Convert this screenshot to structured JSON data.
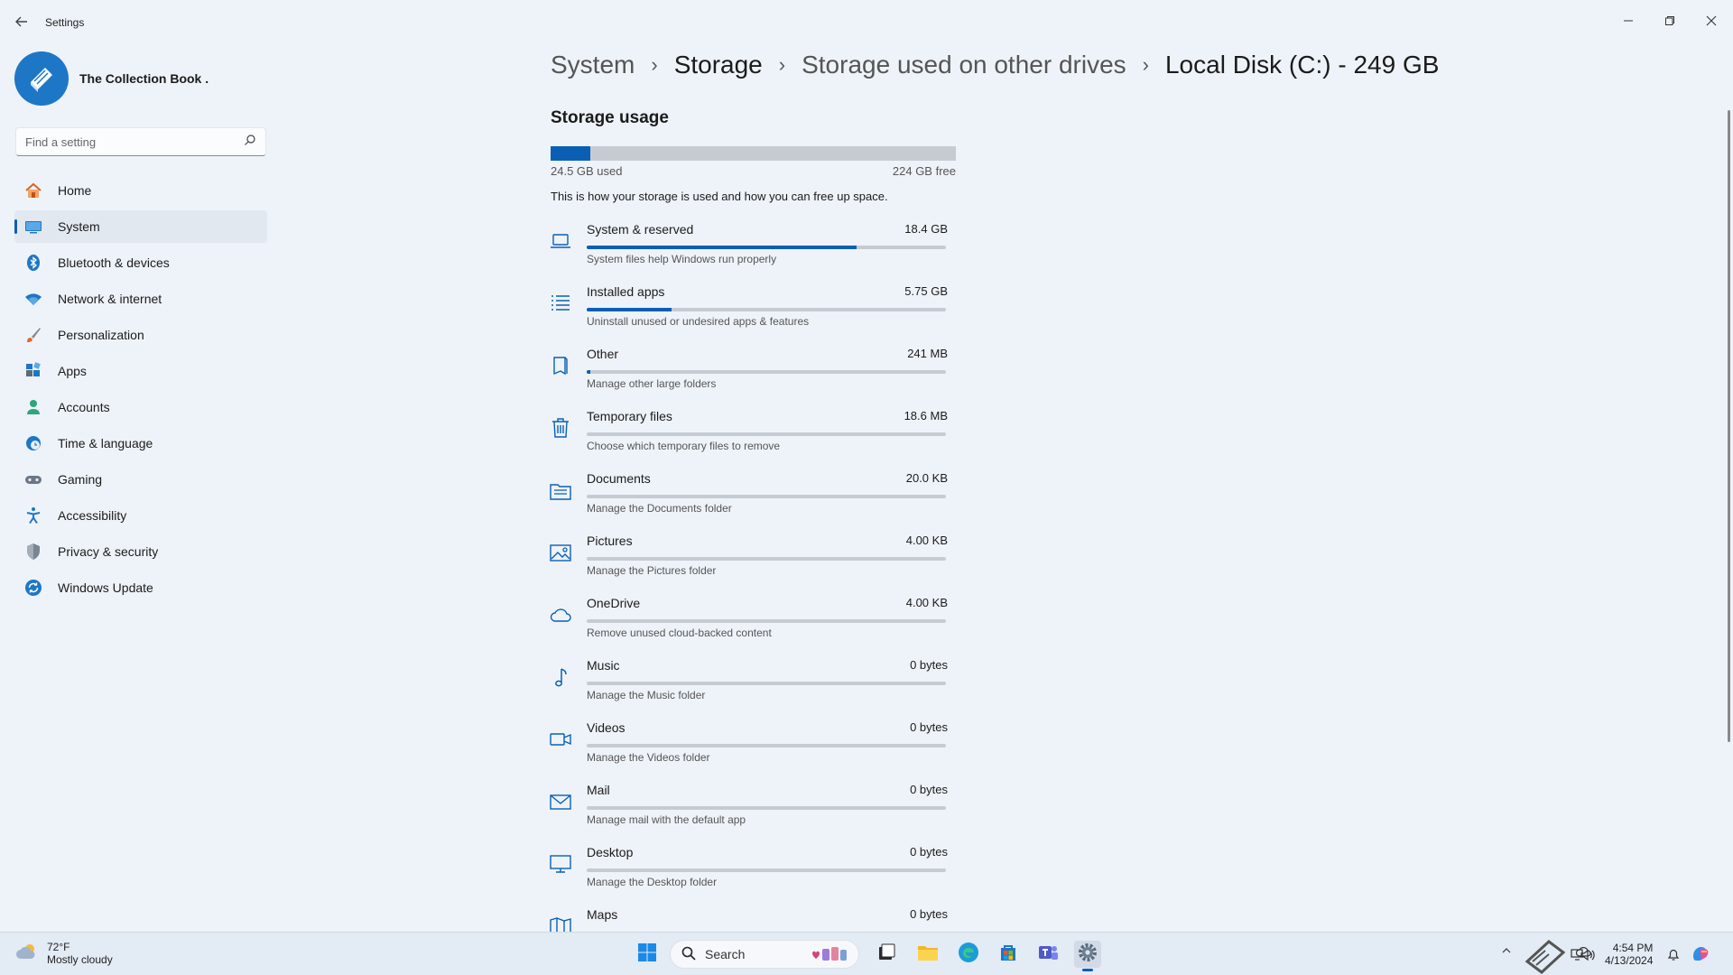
{
  "window": {
    "title": "Settings"
  },
  "profile": {
    "name": "The Collection Book ."
  },
  "search": {
    "placeholder": "Find a setting"
  },
  "nav": [
    {
      "label": "Home",
      "icon": "home-icon",
      "active": false
    },
    {
      "label": "System",
      "icon": "monitor-icon",
      "active": true
    },
    {
      "label": "Bluetooth & devices",
      "icon": "bluetooth-icon",
      "active": false
    },
    {
      "label": "Network & internet",
      "icon": "wifi-icon",
      "active": false
    },
    {
      "label": "Personalization",
      "icon": "brush-icon",
      "active": false
    },
    {
      "label": "Apps",
      "icon": "apps-icon",
      "active": false
    },
    {
      "label": "Accounts",
      "icon": "person-icon",
      "active": false
    },
    {
      "label": "Time & language",
      "icon": "globe-clock-icon",
      "active": false
    },
    {
      "label": "Gaming",
      "icon": "gamepad-icon",
      "active": false
    },
    {
      "label": "Accessibility",
      "icon": "accessibility-icon",
      "active": false
    },
    {
      "label": "Privacy & security",
      "icon": "shield-icon",
      "active": false
    },
    {
      "label": "Windows Update",
      "icon": "update-icon",
      "active": false
    }
  ],
  "breadcrumb": [
    "System",
    "Storage",
    "Storage used on other drives",
    "Local Disk (C:) - 249 GB"
  ],
  "storage": {
    "title": "Storage usage",
    "used": "24.5 GB used",
    "free": "224 GB free",
    "used_fraction": 0.098,
    "description": "This is how your storage is used and how you can free up space."
  },
  "categories": [
    {
      "name": "System & reserved",
      "size": "18.4 GB",
      "sub": "System files help Windows run properly",
      "fraction": 0.75,
      "icon": "laptop-icon"
    },
    {
      "name": "Installed apps",
      "size": "5.75 GB",
      "sub": "Uninstall unused or undesired apps & features",
      "fraction": 0.235,
      "icon": "list-icon"
    },
    {
      "name": "Other",
      "size": "241 MB",
      "sub": "Manage other large folders",
      "fraction": 0.01,
      "icon": "folder-book-icon"
    },
    {
      "name": "Temporary files",
      "size": "18.6 MB",
      "sub": "Choose which temporary files to remove",
      "fraction": 0,
      "icon": "trash-icon"
    },
    {
      "name": "Documents",
      "size": "20.0 KB",
      "sub": "Manage the Documents folder",
      "fraction": 0,
      "icon": "documents-icon"
    },
    {
      "name": "Pictures",
      "size": "4.00 KB",
      "sub": "Manage the Pictures folder",
      "fraction": 0,
      "icon": "picture-icon"
    },
    {
      "name": "OneDrive",
      "size": "4.00 KB",
      "sub": "Remove unused cloud-backed content",
      "fraction": 0,
      "icon": "cloud-icon"
    },
    {
      "name": "Music",
      "size": "0 bytes",
      "sub": "Manage the Music folder",
      "fraction": 0,
      "icon": "music-note-icon"
    },
    {
      "name": "Videos",
      "size": "0 bytes",
      "sub": "Manage the Videos folder",
      "fraction": 0,
      "icon": "video-camera-icon"
    },
    {
      "name": "Mail",
      "size": "0 bytes",
      "sub": "Manage mail with the default app",
      "fraction": 0,
      "icon": "mail-icon"
    },
    {
      "name": "Desktop",
      "size": "0 bytes",
      "sub": "Manage the Desktop folder",
      "fraction": 0,
      "icon": "desktop-icon"
    },
    {
      "name": "Maps",
      "size": "0 bytes",
      "sub": "",
      "fraction": 0,
      "icon": "map-icon"
    }
  ],
  "taskbar": {
    "weather_temp": "72°F",
    "weather_desc": "Mostly cloudy",
    "search_label": "Search",
    "time": "4:54 PM",
    "date": "4/13/2024"
  },
  "colors": {
    "accent": "#0a5fb4",
    "background": "#eef3f9",
    "bar_track": "#c6cbd2"
  }
}
